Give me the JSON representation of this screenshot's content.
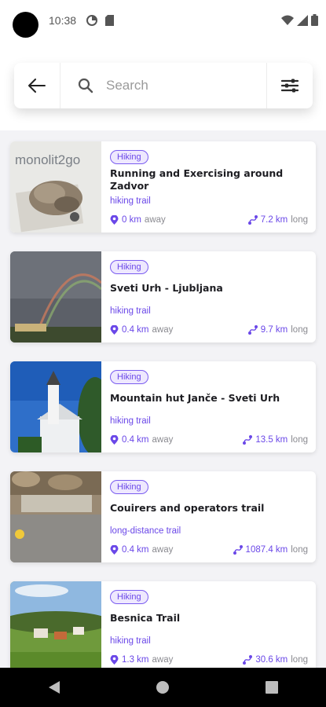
{
  "status": {
    "time": "10:38"
  },
  "search": {
    "placeholder": "Search"
  },
  "trails": [
    {
      "badge": "Hiking",
      "title": "Running and Exercising around Zadvor",
      "type": "hiking trail",
      "distance": "0 km",
      "distance_suffix": "away",
      "length": "7.2 km",
      "length_suffix": "long",
      "thumb_logo": "monolit2go"
    },
    {
      "badge": "Hiking",
      "title": "Sveti Urh - Ljubljana",
      "type": "hiking trail",
      "distance": "0.4 km",
      "distance_suffix": "away",
      "length": "9.7 km",
      "length_suffix": "long"
    },
    {
      "badge": "Hiking",
      "title": "Mountain hut Janče - Sveti Urh",
      "type": "hiking trail",
      "distance": "0.4 km",
      "distance_suffix": "away",
      "length": "13.5 km",
      "length_suffix": "long"
    },
    {
      "badge": "Hiking",
      "title": "Couirers and operators trail",
      "type": "long-distance trail",
      "distance": "0.4 km",
      "distance_suffix": "away",
      "length": "1087.4 km",
      "length_suffix": "long"
    },
    {
      "badge": "Hiking",
      "title": "Besnica Trail",
      "type": "hiking trail",
      "distance": "1.3 km",
      "distance_suffix": "away",
      "length": "30.6 km",
      "length_suffix": "long"
    }
  ],
  "colors": {
    "accent": "#6a47e8",
    "badge_bg": "#eee8fe"
  },
  "icons": {
    "back": "arrow-left-icon",
    "search": "search-icon",
    "filter": "sliders-icon",
    "location": "pin-icon",
    "route": "route-icon"
  }
}
